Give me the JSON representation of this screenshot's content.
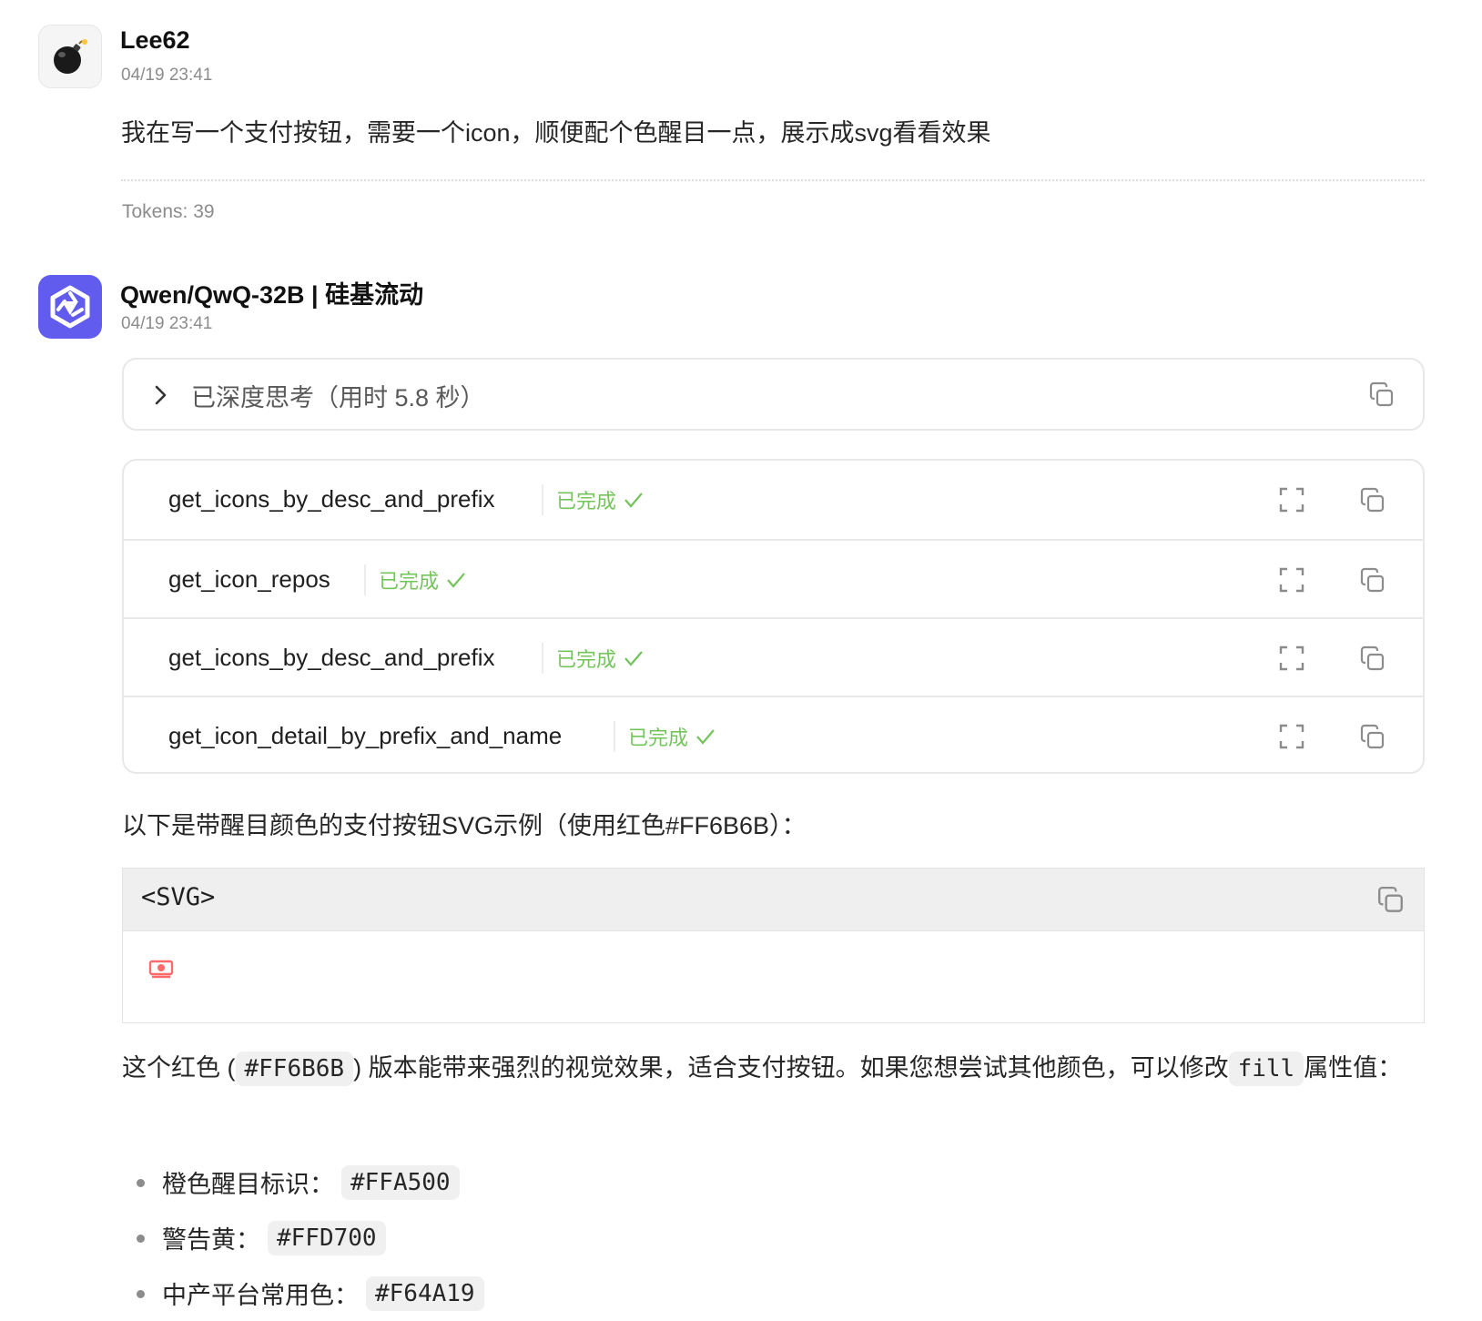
{
  "user_message": {
    "author": "Lee62",
    "time": "04/19 23:41",
    "text": "我在写一个支付按钮，需要一个icon，顺便配个色醒目一点，展示成svg看看效果",
    "tokens": "Tokens: 39"
  },
  "assistant_message": {
    "author": "Qwen/QwQ-32B | 硅基流动",
    "time": "04/19 23:41",
    "thinking_label": "已深度思考（用时 5.8 秒）",
    "tools": [
      {
        "name": "get_icons_by_desc_and_prefix",
        "status": "已完成"
      },
      {
        "name": "get_icon_repos",
        "status": "已完成"
      },
      {
        "name": "get_icons_by_desc_and_prefix",
        "status": "已完成"
      },
      {
        "name": "get_icon_detail_by_prefix_and_name",
        "status": "已完成"
      }
    ],
    "intro": "以下是带醒目颜色的支付按钮SVG示例（使用红色#FF6B6B）：",
    "code_block": {
      "language": "<SVG>"
    },
    "para": {
      "p1": "这个红色 (",
      "c1": "#FF6B6B",
      "p2": ") 版本能带来强烈的视觉效果，适合支付按钮。如果您想尝试其他颜色，可以修改",
      "c2": "fill",
      "p3": "属性值："
    },
    "list": [
      {
        "label": "橙色醒目标识：",
        "code": "#FFA500"
      },
      {
        "label": "警告黄：",
        "code": "#FFD700"
      },
      {
        "label": "中产平台常用色：",
        "code": "#F64A19"
      }
    ]
  },
  "colors": {
    "bot_avatar": "#615ced",
    "success": "#74c45c",
    "payment_icon": "#FF6B6B"
  },
  "icons": {
    "user_avatar": "bomb-icon",
    "bot_avatar": "qwen-logo-icon",
    "chevron": "chevron-right-icon",
    "copy": "copy-icon",
    "expand": "expand-icon",
    "check": "check-icon",
    "payment": "money-icon"
  }
}
